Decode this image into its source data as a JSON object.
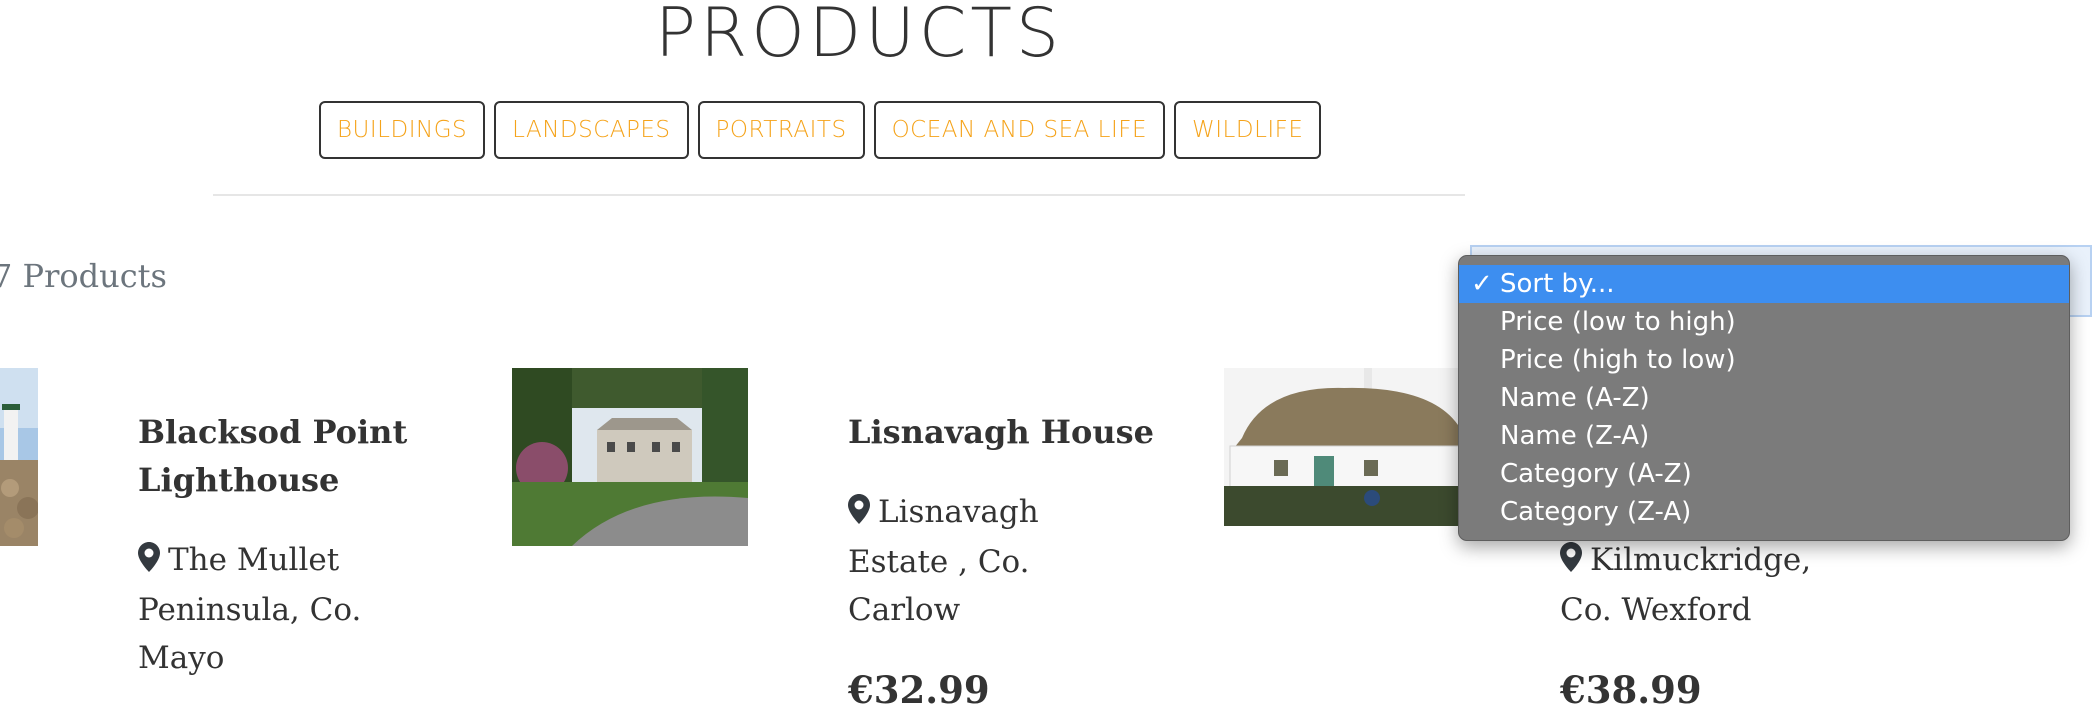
{
  "page": {
    "title": "PRODUCTS"
  },
  "categories": [
    "BUILDINGS",
    "LANDSCAPES",
    "PORTRAITS",
    "OCEAN AND SEA LIFE",
    "WILDLIFE"
  ],
  "product_count": "7 Products",
  "sort": {
    "options": [
      "Sort by...",
      "Price (low to high)",
      "Price (high to low)",
      "Name (A-Z)",
      "Name (Z-A)",
      "Category (A-Z)",
      "Category (Z-A)"
    ],
    "selected_index": 0,
    "check_mark": "✓"
  },
  "products": [
    {
      "title_lines": [
        "Blacksod Point",
        "Lighthouse"
      ],
      "location_lines": [
        "The Mullet",
        "Peninsula, Co.",
        "Mayo"
      ]
    },
    {
      "title_lines": [
        "Lisnavagh House"
      ],
      "location_lines": [
        "Lisnavagh",
        "Estate , Co.",
        "Carlow"
      ],
      "price": "€32.99"
    },
    {
      "location_lines": [
        "Kilmuckridge,",
        "Co. Wexford"
      ],
      "price": "€38.99"
    }
  ],
  "colors": {
    "accent": "#f5a31a",
    "dropdown_bg": "#7b7b7b",
    "dropdown_selected": "#3d8ef0"
  }
}
